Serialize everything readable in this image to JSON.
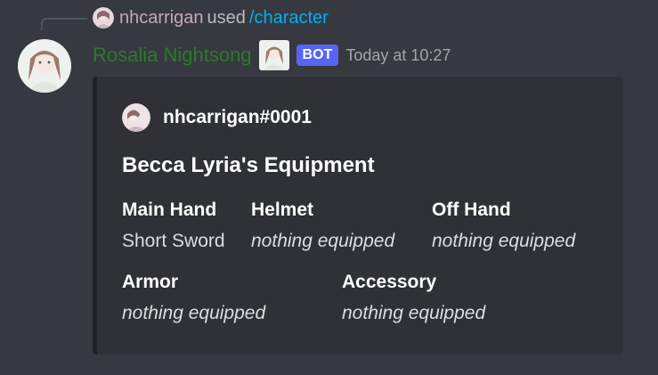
{
  "reply": {
    "user": "nhcarrigan",
    "used_text": "used",
    "command": "/character"
  },
  "message": {
    "username": "Rosalia Nightsong",
    "bot_tag": "BOT",
    "timestamp": "Today at 10:27"
  },
  "embed": {
    "author": "nhcarrigan#0001",
    "title": "Becca Lyria's Equipment",
    "fields": [
      {
        "name": "Main Hand",
        "value": "Short Sword"
      },
      {
        "name": "Helmet",
        "value": "nothing equipped"
      },
      {
        "name": "Off Hand",
        "value": "nothing equipped"
      },
      {
        "name": "Armor",
        "value": "nothing equipped"
      },
      {
        "name": "Accessory",
        "value": "nothing equipped"
      }
    ]
  },
  "colors": {
    "background": "#36393f",
    "embed_background": "#2f3136",
    "username": "#2d7a2a",
    "bot_tag": "#5865f2",
    "command_link": "#00aff4"
  },
  "icons": [
    "user-avatar-icon",
    "bot-avatar-icon",
    "author-avatar-icon"
  ]
}
